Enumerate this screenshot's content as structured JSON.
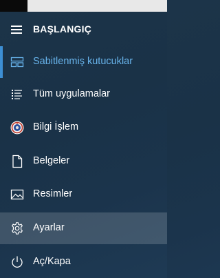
{
  "header": {
    "title": "BAŞLANGIÇ"
  },
  "menu": {
    "items": [
      {
        "label": "Sabitlenmiş kutucuklar",
        "icon": "pinned-tiles-icon"
      },
      {
        "label": "Tüm uygulamalar",
        "icon": "all-apps-list-icon"
      },
      {
        "label": "Bilgi İşlem",
        "icon": "user-avatar-icon"
      },
      {
        "label": "Belgeler",
        "icon": "document-icon"
      },
      {
        "label": "Resimler",
        "icon": "pictures-icon"
      },
      {
        "label": "Ayarlar",
        "icon": "gear-icon"
      },
      {
        "label": "Aç/Kapa",
        "icon": "power-icon"
      }
    ],
    "selected": "Sabitlenmiş kutucuklar",
    "hovered": "Ayarlar"
  },
  "colors": {
    "accent": "#3d8fd4",
    "selected_text": "#68b4ec",
    "background": "#1b3449"
  }
}
